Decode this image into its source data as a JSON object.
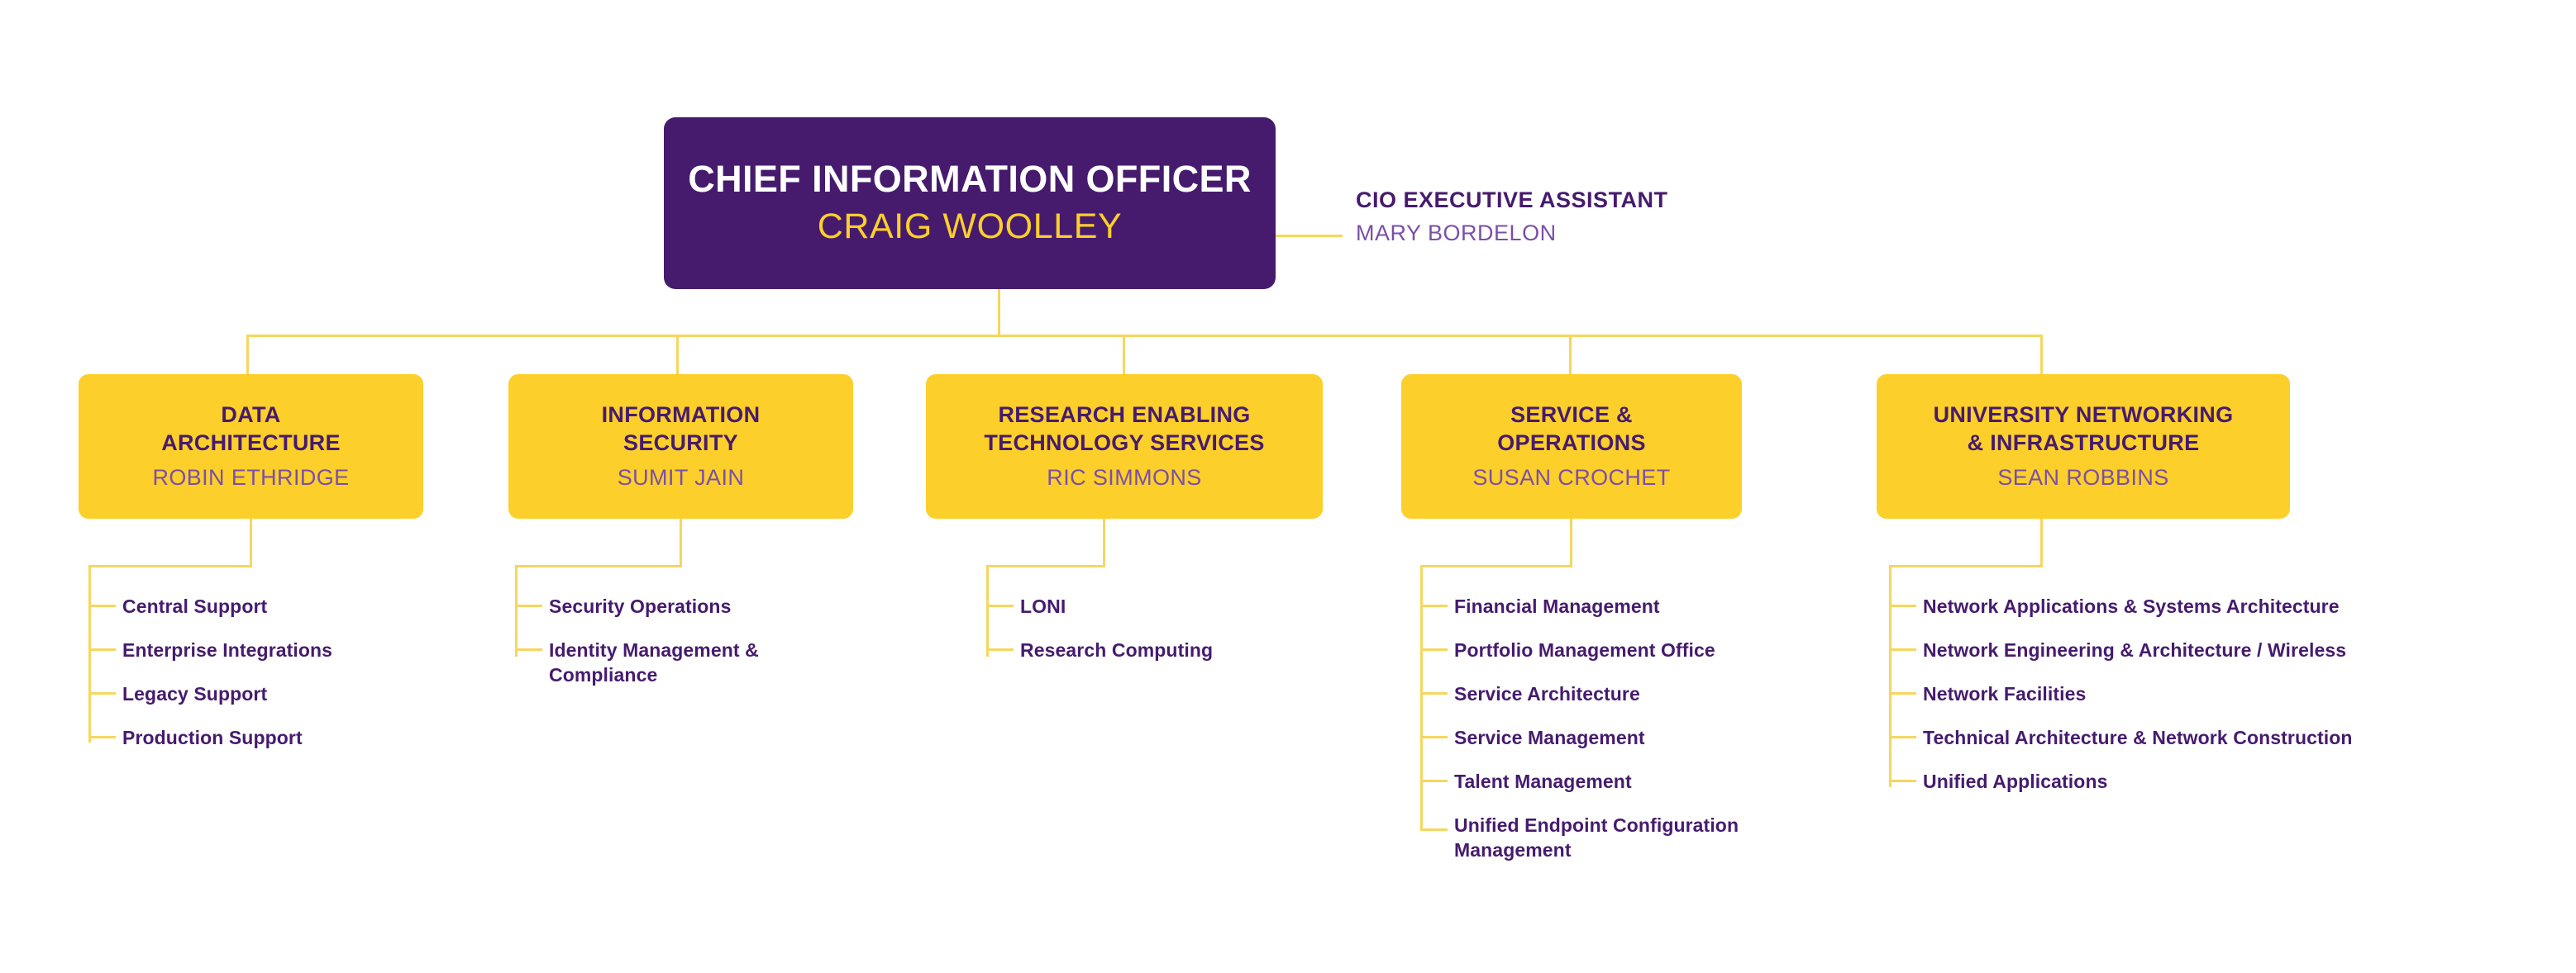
{
  "chart": {
    "type": "org-chart",
    "colors": {
      "purple": "#461B6E",
      "yellow": "#FDCF2A",
      "connector": "#F6D660",
      "name_purple": "#7B4FA8",
      "white": "#FFFFFF",
      "background": "#FFFFFF"
    }
  },
  "executive": {
    "title": "CHIEF INFORMATION OFFICER",
    "name": "CRAIG WOOLLEY"
  },
  "assistant": {
    "title": "CIO EXECUTIVE ASSISTANT",
    "name": "MARY BORDELON"
  },
  "departments": [
    {
      "title_line1": "DATA",
      "title_line2": "ARCHITECTURE",
      "name": "ROBIN ETHRIDGE",
      "units": [
        "Central Support",
        "Enterprise Integrations",
        "Legacy Support",
        "Production Support"
      ]
    },
    {
      "title_line1": "INFORMATION",
      "title_line2": "SECURITY",
      "name": "SUMIT JAIN",
      "units": [
        "Security Operations",
        "Identity Management & Compliance"
      ]
    },
    {
      "title_line1": "RESEARCH ENABLING",
      "title_line2": "TECHNOLOGY SERVICES",
      "name": "RIC SIMMONS",
      "units": [
        "LONI",
        "Research Computing"
      ]
    },
    {
      "title_line1": "SERVICE &",
      "title_line2": "OPERATIONS",
      "name": "SUSAN CROCHET",
      "units": [
        "Financial Management",
        "Portfolio Management Office",
        "Service Architecture",
        "Service Management",
        "Talent Management",
        "Unified Endpoint Configuration Management"
      ]
    },
    {
      "title_line1": "UNIVERSITY NETWORKING",
      "title_line2": "& INFRASTRUCTURE",
      "name": "SEAN ROBBINS",
      "units": [
        "Network Applications & Systems Architecture",
        "Network Engineering & Architecture / Wireless",
        "Network Facilities",
        "Technical Architecture & Network Construction",
        "Unified Applications"
      ]
    }
  ]
}
